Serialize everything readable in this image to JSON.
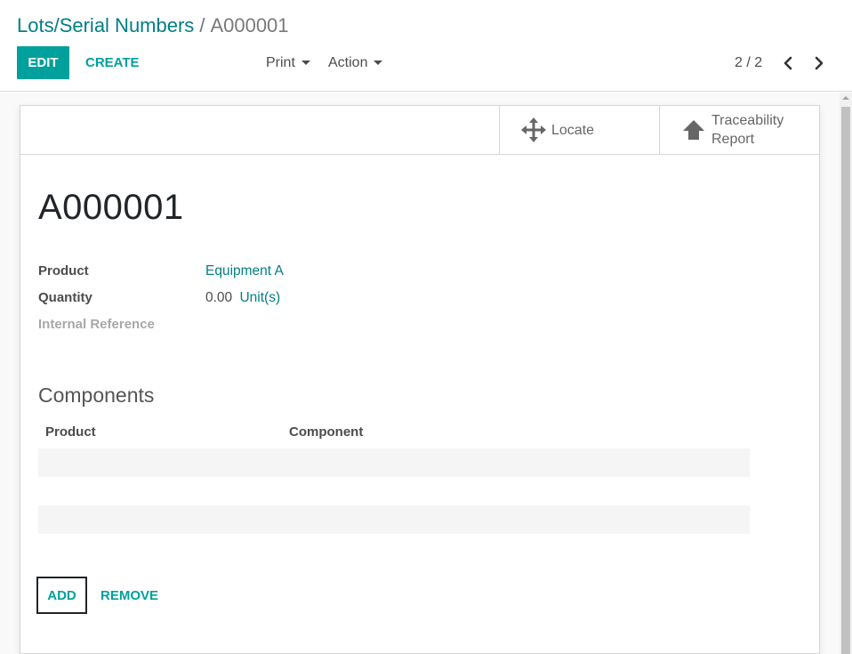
{
  "breadcrumb": {
    "parent": "Lots/Serial Numbers",
    "separator": "/",
    "current": "A000001"
  },
  "toolbar": {
    "edit_label": "EDIT",
    "create_label": "CREATE",
    "print_label": "Print",
    "action_label": "Action"
  },
  "pager": {
    "value": "2 / 2",
    "prev_icon": "chevron-left-icon",
    "next_icon": "chevron-right-icon"
  },
  "smart_buttons": [
    {
      "label": "Locate",
      "icon": "arrows-move-icon"
    },
    {
      "label_line1": "Traceability",
      "label_line2": "Report",
      "icon": "arrow-up-icon"
    }
  ],
  "record": {
    "name": "A000001",
    "fields": {
      "product_label": "Product",
      "product_value": "Equipment A",
      "quantity_label": "Quantity",
      "quantity_value": "0.00",
      "quantity_uom": "Unit(s)",
      "internal_ref_label": "Internal Reference"
    }
  },
  "components": {
    "title": "Components",
    "columns": [
      "Product",
      "Component"
    ],
    "add_label": "ADD",
    "remove_label": "REMOVE"
  },
  "colors": {
    "primary": "#00a09d",
    "link": "#017e84",
    "text": "#4c4c4c"
  }
}
